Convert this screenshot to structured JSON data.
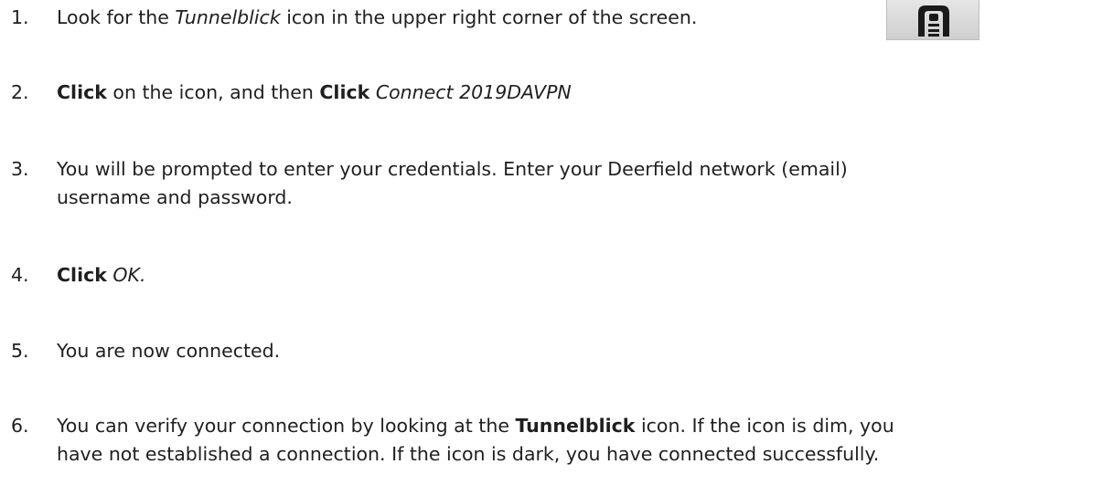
{
  "steps": [
    {
      "number": "1.",
      "text_a": "Look for the ",
      "em": "Tunnelblick",
      "text_b": " icon in the upper right corner of the screen."
    },
    {
      "number": "2.",
      "bold_a": "Click",
      "text_a": " on the icon, and then ",
      "bold_b": "Click",
      "text_b": " ",
      "em": "Connect 2019DAVPN"
    },
    {
      "number": "3.",
      "line1": "You will be prompted to enter your credentials.  Enter your Deerfield network (email)",
      "line2": "username and password."
    },
    {
      "number": "4.",
      "bold": "Click",
      "text": " ",
      "em": "OK."
    },
    {
      "number": "5.",
      "text": "You are now connected."
    },
    {
      "number": "6.",
      "text_a": "You can verify your connection by looking at the ",
      "bold": "Tunnelblick",
      "text_b": " icon.  If the icon is dim, you",
      "line2": "have not established a connection.  If the icon is dark, you have connected successfully."
    }
  ],
  "icon": {
    "name": "tunnelblick-icon",
    "color": "#1a1a1a",
    "background": "#d8d8d8"
  }
}
